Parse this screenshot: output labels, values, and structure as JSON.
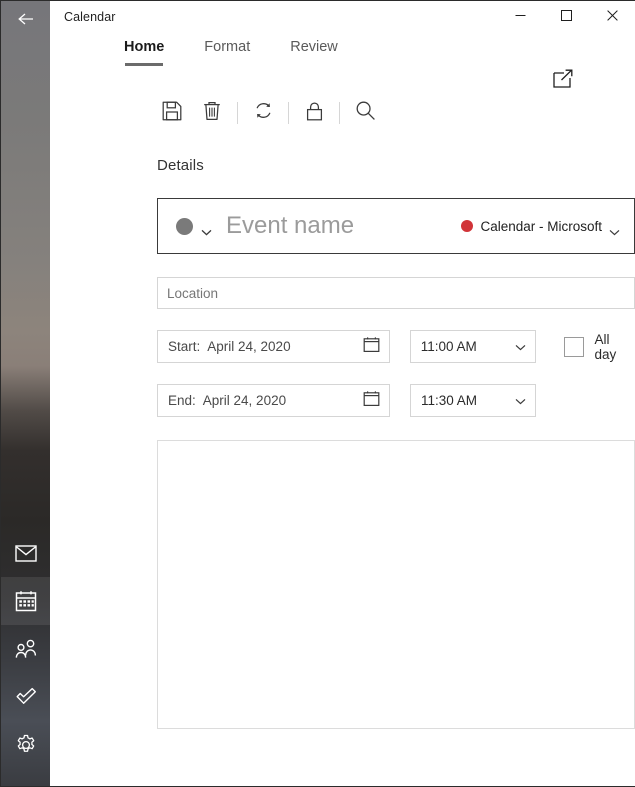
{
  "window": {
    "title": "Calendar",
    "minimize_label": "—",
    "maximize_label": "□",
    "close_label": "✕"
  },
  "sidebar": {
    "back_icon": "back-arrow-icon",
    "items": [
      {
        "name": "mail",
        "icon": "mail-icon",
        "selected": false
      },
      {
        "name": "calendar",
        "icon": "calendar-icon",
        "selected": true
      },
      {
        "name": "people",
        "icon": "people-icon",
        "selected": false
      },
      {
        "name": "tasks",
        "icon": "tasks-check-icon",
        "selected": false
      },
      {
        "name": "settings",
        "icon": "gear-icon",
        "selected": false
      }
    ]
  },
  "ribbon": {
    "tabs": [
      {
        "label": "Home",
        "active": true
      },
      {
        "label": "Format",
        "active": false
      },
      {
        "label": "Review",
        "active": false
      }
    ],
    "popout_icon": "open-in-new-window-icon",
    "toolbar": [
      {
        "name": "save",
        "icon": "save-floppy-icon"
      },
      {
        "name": "delete",
        "icon": "trash-icon"
      },
      {
        "name": "sync",
        "icon": "sync-refresh-icon"
      },
      {
        "name": "private",
        "icon": "lock-icon"
      },
      {
        "name": "search",
        "icon": "search-icon"
      }
    ]
  },
  "details": {
    "section_title": "Details",
    "event": {
      "category_color": "#7a7a7a",
      "category_chevron_icon": "chevron-down-icon",
      "name_value": "",
      "name_placeholder": "Event name",
      "calendar_color": "#d13438",
      "calendar_label": "Calendar - Microsoft",
      "calendar_chevron_icon": "chevron-down-icon"
    },
    "location": {
      "value": "",
      "placeholder": "Location"
    },
    "start": {
      "prefix": "Start:",
      "date": "April 24, 2020",
      "calendar_icon": "calendar-picker-icon",
      "time": "11:00 AM",
      "time_chevron_icon": "chevron-down-icon"
    },
    "end": {
      "prefix": "End:",
      "date": "April 24, 2020",
      "calendar_icon": "calendar-picker-icon",
      "time": "11:30 AM",
      "time_chevron_icon": "chevron-down-icon"
    },
    "all_day": {
      "label": "All day",
      "checked": false
    },
    "notes": {
      "value": "",
      "placeholder": ""
    }
  },
  "colors": {
    "accent_red": "#d13438",
    "tab_underline": "#6b6b6b",
    "border_strong": "#3a3a3a",
    "border_light": "#d5d5d5"
  }
}
